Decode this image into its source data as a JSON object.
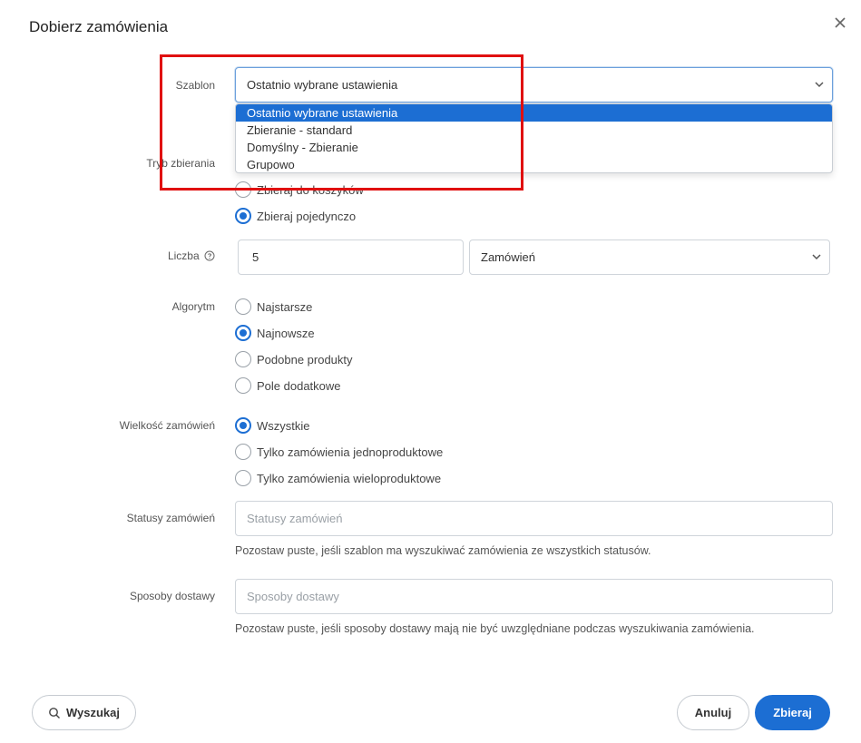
{
  "dialog": {
    "title": "Dobierz zamówienia",
    "close_icon": "close-icon"
  },
  "template": {
    "label": "Szablon",
    "value": "Ostatnio wybrane ustawienia",
    "options": [
      "Ostatnio wybrane ustawienia",
      "Zbieranie - standard",
      "Domyślny - Zbieranie",
      "Grupowo"
    ],
    "selected_index": 0
  },
  "mode": {
    "label": "Tryb zbierania",
    "options": [
      {
        "label": "Zbieraj do koszyków",
        "checked": false
      },
      {
        "label": "Zbieraj pojedynczo",
        "checked": true
      }
    ]
  },
  "count": {
    "label": "Liczba",
    "value": "5",
    "unit": "Zamówień",
    "info_icon": "question-circle-icon"
  },
  "algorithm": {
    "label": "Algorytm",
    "options": [
      {
        "label": "Najstarsze",
        "checked": false
      },
      {
        "label": "Najnowsze",
        "checked": true
      },
      {
        "label": "Podobne produkty",
        "checked": false
      },
      {
        "label": "Pole dodatkowe",
        "checked": false
      }
    ]
  },
  "size": {
    "label": "Wielkość zamówień",
    "options": [
      {
        "label": "Wszystkie",
        "checked": true
      },
      {
        "label": "Tylko zamówienia jednoproduktowe",
        "checked": false
      },
      {
        "label": "Tylko zamówienia wieloproduktowe",
        "checked": false
      }
    ]
  },
  "statuses": {
    "label": "Statusy zamówień",
    "placeholder": "Statusy zamówień",
    "help": "Pozostaw puste, jeśli szablon ma wyszukiwać zamówienia ze wszystkich statusów."
  },
  "delivery": {
    "label": "Sposoby dostawy",
    "placeholder": "Sposoby dostawy",
    "help": "Pozostaw puste, jeśli sposoby dostawy mają nie być uwzględniane podczas wyszukiwania zamówienia."
  },
  "footer": {
    "search_label": "Wyszukaj",
    "cancel_label": "Anuluj",
    "submit_label": "Zbieraj"
  },
  "colors": {
    "accent": "#1c6ed3",
    "highlight": "#e01010"
  }
}
